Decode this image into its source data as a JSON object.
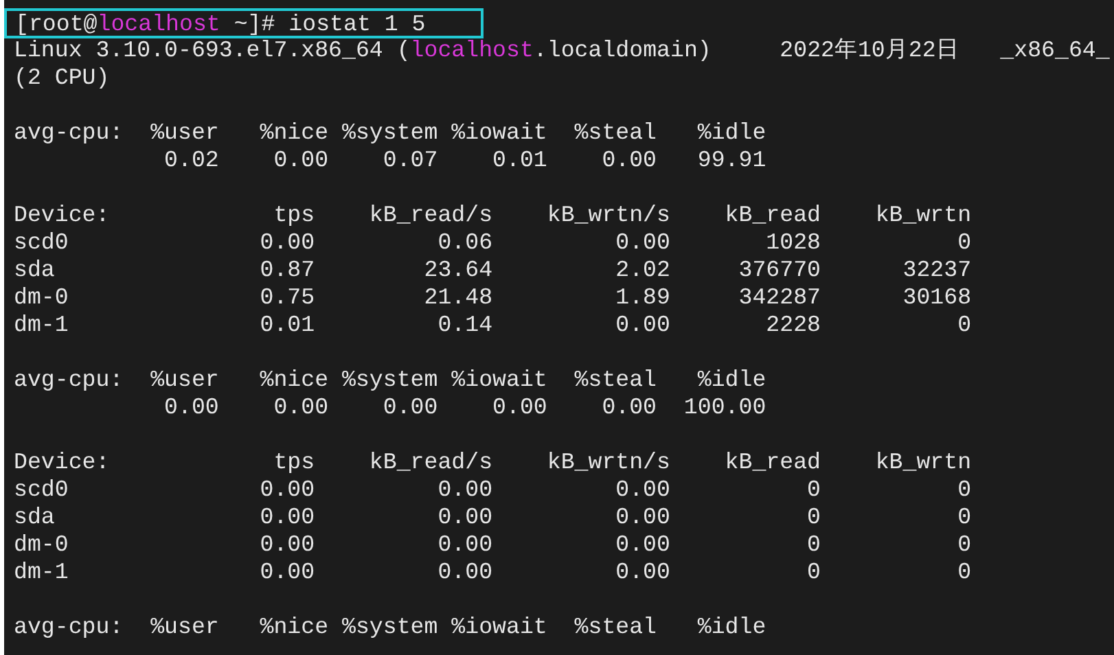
{
  "terminal": {
    "lines": [
      {
        "kind": "prompt",
        "highlighted": true,
        "segments": [
          {
            "text": "[root@",
            "accent": false
          },
          {
            "text": "localhost",
            "accent": true
          },
          {
            "text": " ~]# iostat 1 5",
            "accent": false
          }
        ]
      },
      {
        "kind": "output",
        "segments": [
          {
            "text": "Linux 3.10.0-693.el7.x86_64 (",
            "accent": false
          },
          {
            "text": "localhost",
            "accent": true
          },
          {
            "text": ".localdomain)     2022年10月22日   _x86_64_",
            "accent": false
          }
        ]
      },
      {
        "kind": "output",
        "segments": [
          {
            "text": "(2 CPU)",
            "accent": false
          }
        ]
      },
      {
        "kind": "blank"
      },
      {
        "kind": "output",
        "segments": [
          {
            "text": "avg-cpu:  %user   %nice %system %iowait  %steal   %idle",
            "accent": false
          }
        ]
      },
      {
        "kind": "output",
        "segments": [
          {
            "text": "           0.02    0.00    0.07    0.01    0.00   99.91",
            "accent": false
          }
        ]
      },
      {
        "kind": "blank"
      },
      {
        "kind": "output",
        "segments": [
          {
            "text": "Device:            tps    kB_read/s    kB_wrtn/s    kB_read    kB_wrtn",
            "accent": false
          }
        ]
      },
      {
        "kind": "output",
        "segments": [
          {
            "text": "scd0              0.00         0.06         0.00       1028          0",
            "accent": false
          }
        ]
      },
      {
        "kind": "output",
        "segments": [
          {
            "text": "sda               0.87        23.64         2.02     376770      32237",
            "accent": false
          }
        ]
      },
      {
        "kind": "output",
        "segments": [
          {
            "text": "dm-0              0.75        21.48         1.89     342287      30168",
            "accent": false
          }
        ]
      },
      {
        "kind": "output",
        "segments": [
          {
            "text": "dm-1              0.01         0.14         0.00       2228          0",
            "accent": false
          }
        ]
      },
      {
        "kind": "blank"
      },
      {
        "kind": "output",
        "segments": [
          {
            "text": "avg-cpu:  %user   %nice %system %iowait  %steal   %idle",
            "accent": false
          }
        ]
      },
      {
        "kind": "output",
        "segments": [
          {
            "text": "           0.00    0.00    0.00    0.00    0.00  100.00",
            "accent": false
          }
        ]
      },
      {
        "kind": "blank"
      },
      {
        "kind": "output",
        "segments": [
          {
            "text": "Device:            tps    kB_read/s    kB_wrtn/s    kB_read    kB_wrtn",
            "accent": false
          }
        ]
      },
      {
        "kind": "output",
        "segments": [
          {
            "text": "scd0              0.00         0.00         0.00          0          0",
            "accent": false
          }
        ]
      },
      {
        "kind": "output",
        "segments": [
          {
            "text": "sda               0.00         0.00         0.00          0          0",
            "accent": false
          }
        ]
      },
      {
        "kind": "output",
        "segments": [
          {
            "text": "dm-0              0.00         0.00         0.00          0          0",
            "accent": false
          }
        ]
      },
      {
        "kind": "output",
        "segments": [
          {
            "text": "dm-1              0.00         0.00         0.00          0          0",
            "accent": false
          }
        ]
      },
      {
        "kind": "blank"
      },
      {
        "kind": "output",
        "segments": [
          {
            "text": "avg-cpu:  %user   %nice %system %iowait  %steal   %idle",
            "accent": false
          }
        ]
      }
    ]
  }
}
